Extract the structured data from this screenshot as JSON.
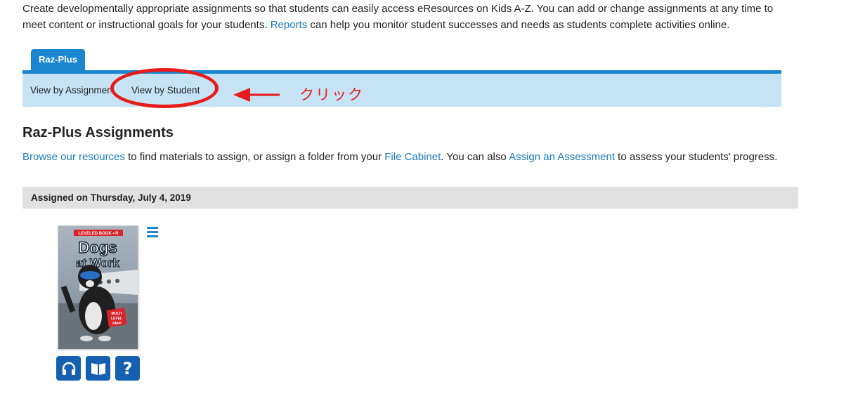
{
  "intro": {
    "text_before": "Create developmentally appropriate assignments so that students can easily access eResources on Kids A-Z. You can add or change assignments at any time to meet content or instructional goals for your students. ",
    "reports_link": "Reports",
    "text_after": " can help you monitor student successes and needs as students complete activities online."
  },
  "tabs": {
    "active_tab": "Raz-Plus",
    "subnav": [
      "View by Assignment",
      "View by Student"
    ]
  },
  "annotation": {
    "text": "クリック",
    "color": "#e81a1a"
  },
  "section": {
    "heading": "Raz-Plus Assignments",
    "browse_link": "Browse our resources",
    "text_1": " to find materials to assign, or assign a folder from your ",
    "file_cabinet_link": "File Cabinet",
    "text_2": ". You can also ",
    "assessment_link": "Assign an Assessment",
    "text_3": " to assess your students' progress."
  },
  "assignment_group": {
    "date_label": "Assigned on Thursday, July 4, 2019"
  },
  "book": {
    "series_label": "LEVELED BOOK • R",
    "title_line1": "Dogs",
    "title_line2": "at Work",
    "badge_lines": [
      "MULTI",
      "LEVEL",
      "J•M•P"
    ]
  },
  "actions": {
    "listen": "headphones-icon",
    "read": "open-book-icon",
    "quiz": "question-icon"
  },
  "colors": {
    "accent": "#1a86d0",
    "subnav_bg": "#c6e3f6",
    "link": "#1a7bbf",
    "button": "#1560b0"
  }
}
